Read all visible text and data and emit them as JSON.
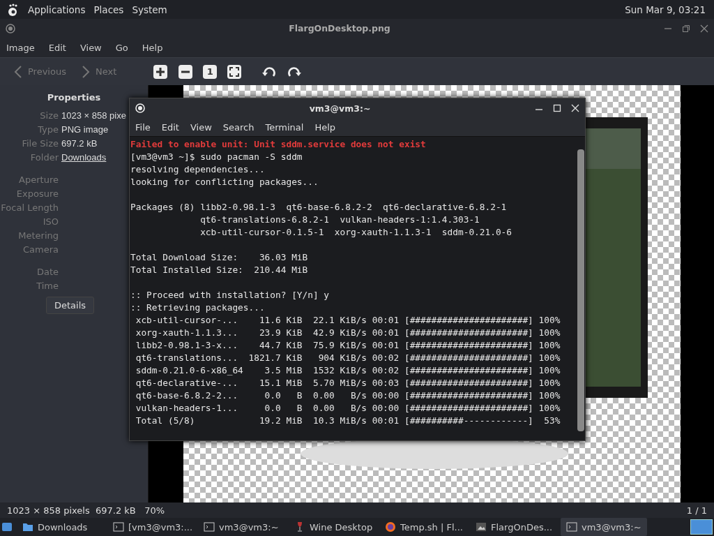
{
  "top_panel": {
    "menus": [
      "Applications",
      "Places",
      "System"
    ],
    "clock": "Sun Mar  9, 03:21"
  },
  "window": {
    "title": "FlargOnDesktop.png"
  },
  "menubar": [
    "Image",
    "Edit",
    "View",
    "Go",
    "Help"
  ],
  "toolbar": {
    "previous": "Previous",
    "next": "Next",
    "zoom_normal": "1"
  },
  "properties": {
    "title": "Properties",
    "rows": [
      {
        "label": "Size",
        "value": "1023 × 858 pixe",
        "kind": "text"
      },
      {
        "label": "Type",
        "value": "PNG image",
        "kind": "text"
      },
      {
        "label": "File Size",
        "value": "697.2 kB",
        "kind": "text"
      },
      {
        "label": "Folder",
        "value": "Downloads",
        "kind": "link"
      },
      {
        "label": "Aperture",
        "kind": "gap"
      },
      {
        "label": "Exposure",
        "kind": "text"
      },
      {
        "label": "Focal Length",
        "kind": "text"
      },
      {
        "label": "ISO",
        "kind": "text"
      },
      {
        "label": "Metering",
        "kind": "text"
      },
      {
        "label": "Camera",
        "kind": "text"
      },
      {
        "label": "Date",
        "kind": "gap"
      },
      {
        "label": "Time",
        "kind": "text"
      }
    ],
    "details_button": "Details"
  },
  "terminal": {
    "title": "vm3@vm3:~",
    "menus": [
      "File",
      "Edit",
      "View",
      "Search",
      "Terminal",
      "Help"
    ],
    "lines": [
      {
        "text": "Failed to enable unit: Unit sddm.service does not exist",
        "kind": "error"
      },
      {
        "text": "[vm3@vm3 ~]$ sudo pacman -S sddm",
        "kind": "normal"
      },
      {
        "text": "resolving dependencies...",
        "kind": "normal"
      },
      {
        "text": "looking for conflicting packages...",
        "kind": "normal"
      },
      {
        "kind": "blank"
      },
      {
        "text": "Packages (8) libb2-0.98.1-3  qt6-base-6.8.2-2  qt6-declarative-6.8.2-1",
        "kind": "normal"
      },
      {
        "text": "             qt6-translations-6.8.2-1  vulkan-headers-1:1.4.303-1",
        "kind": "normal"
      },
      {
        "text": "             xcb-util-cursor-0.1.5-1  xorg-xauth-1.1.3-1  sddm-0.21.0-6",
        "kind": "normal"
      },
      {
        "kind": "blank"
      },
      {
        "text": "Total Download Size:    36.03 MiB",
        "kind": "normal"
      },
      {
        "text": "Total Installed Size:  210.44 MiB",
        "kind": "normal"
      },
      {
        "kind": "blank"
      },
      {
        "text": ":: Proceed with installation? [Y/n] y",
        "kind": "normal"
      },
      {
        "text": ":: Retrieving packages...",
        "kind": "normal"
      },
      {
        "text": " xcb-util-cursor-...    11.6 KiB  22.1 KiB/s 00:01 [######################] 100%",
        "kind": "normal"
      },
      {
        "text": " xorg-xauth-1.1.3...    23.9 KiB  42.9 KiB/s 00:01 [######################] 100%",
        "kind": "normal"
      },
      {
        "text": " libb2-0.98.1-3-x...    44.7 KiB  75.9 KiB/s 00:01 [######################] 100%",
        "kind": "normal"
      },
      {
        "text": " qt6-translations...  1821.7 KiB   904 KiB/s 00:02 [######################] 100%",
        "kind": "normal"
      },
      {
        "text": " sddm-0.21.0-6-x86_64    3.5 MiB  1532 KiB/s 00:02 [######################] 100%",
        "kind": "normal"
      },
      {
        "text": " qt6-declarative-...    15.1 MiB  5.70 MiB/s 00:03 [######################] 100%",
        "kind": "normal"
      },
      {
        "text": " qt6-base-6.8.2-2...     0.0   B  0.00   B/s 00:00 [######################] 100%",
        "kind": "normal"
      },
      {
        "text": " vulkan-headers-1...     0.0   B  0.00   B/s 00:00 [######################] 100%",
        "kind": "normal"
      },
      {
        "text": " Total (5/8)            19.2 MiB  10.3 MiB/s 00:01 [##########------------]  53%",
        "kind": "normal"
      }
    ]
  },
  "status_bar": {
    "info": "1023 × 858 pixels  697.2 kB   70%",
    "position": "1 / 1"
  },
  "taskbar": [
    {
      "label": "Downloads",
      "kind": "folder",
      "selected": false
    },
    {
      "label": "[vm3@vm3:...",
      "kind": "terminal",
      "selected": false
    },
    {
      "label": "vm3@vm3:~",
      "kind": "terminal",
      "selected": false
    },
    {
      "label": "Wine Desktop",
      "kind": "wine",
      "selected": false
    },
    {
      "label": "Temp.sh | Fl...",
      "kind": "browser",
      "selected": false
    },
    {
      "label": "FlargOnDes...",
      "kind": "viewer",
      "selected": false
    },
    {
      "label": "vm3@vm3:~",
      "kind": "terminal",
      "selected": true
    }
  ]
}
